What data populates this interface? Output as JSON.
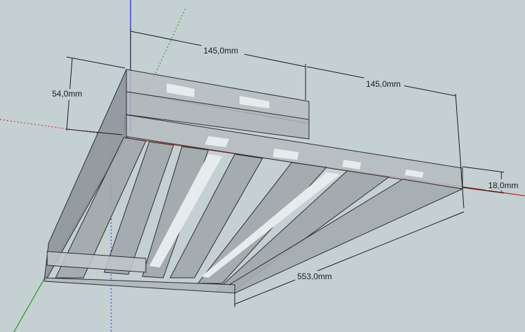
{
  "viewport": {
    "background": "#c5d0d3",
    "axis_colors": {
      "red": "#d21f1f",
      "green": "#1a9a1a",
      "blue": "#1f1fd8"
    }
  },
  "dimensions": {
    "width_left": "145,0mm",
    "width_right": "145,0mm",
    "height": "54,0mm",
    "thickness": "18,0mm",
    "length": "553,0mm"
  }
}
